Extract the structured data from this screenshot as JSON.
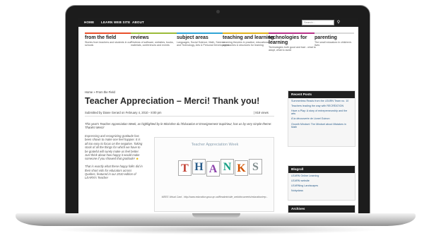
{
  "nav": {
    "items": [
      "HOME",
      "LEARN WEB SITE",
      "ABOUT"
    ],
    "search_placeholder": "Search..."
  },
  "categories": [
    {
      "title": "from the field",
      "desc": "Stories from teachers and students in our schools",
      "color": "#e8502b"
    },
    {
      "title": "reviews",
      "desc": "Reviews of software, websites, books, materials, conferences and events",
      "color": "#9bbb3a"
    },
    {
      "title": "subject areas",
      "desc": "Languages, Social Science, Math, Science and Technology, Arts & Personal Development",
      "color": "#31a5d6"
    },
    {
      "title": "teaching and learning",
      "desc": "Learning theories in practice, educational approaches & structures for learning",
      "color": "#e0b21d"
    },
    {
      "title": "technologies for learning",
      "desc": "Technologies both good and bad - what to adopt, what to avoid",
      "color": "#b83288"
    },
    {
      "title": "parenting",
      "desc": "The small educators in children's lives",
      "color": "#d9d9d9"
    }
  ],
  "article": {
    "breadcrumb": "Home » From the Field",
    "title": "Teacher Appreciation – Merci! Thank you!",
    "submitted": "Submitted by Diane Gerard on February 4, 2010 - 8:00 pm",
    "views": "| 818 views",
    "intro": "This year's Teacher Appreciation Week, as highlighted by le Ministère du l'Éducation et Enseignement Supérieur, has us by very simple theme: Thanks! Merci!",
    "body": "Expressing and recognizing gratitude has been shown to make one feel happier. It is all too easy to focus on the negative. Taking stock of all the things for which we have to be grateful will surely make us feel better. Just think about how happy it would make someone if you showed that gratitude!",
    "body2": "That is exactly what these happy folks did in their short vids for educators across Quebec, featured in our 2010 edition of LEARN's Teacher",
    "smile": "☻"
  },
  "card": {
    "title": "Teacher Appreciation Week",
    "letters": [
      "T",
      "H",
      "A",
      "N",
      "K",
      "S"
    ],
    "caption": "MEES Virtual Card - http://www.education.gouv.qc.ca/fileadmin/site_web/documents/education/rep..."
  },
  "sidebar": {
    "recent_posts": {
      "title": "Recent Posts",
      "items": [
        "Summerless Reads from the LEARN Team no. 10",
        "Teachers leading the way with RECRÉATION",
        "Have a Play: A story of entrepreneurship and the arts",
        "À la découverte de Lionel Guinon",
        "Growth Mindset: The Mindset about Mistakes in Math"
      ]
    },
    "blogroll": {
      "title": "Blogroll",
      "items": [
        "LEARN Online Learning",
        "LEARN website",
        "LEARNing Landscapes",
        "Nobyclass"
      ]
    },
    "archives": {
      "title": "Archives"
    }
  },
  "colors": {
    "tile_colors": [
      "#c0392b",
      "#2a5d8a",
      "#8e44ad",
      "#16a085",
      "#d35400",
      "#7f8c8d"
    ]
  }
}
